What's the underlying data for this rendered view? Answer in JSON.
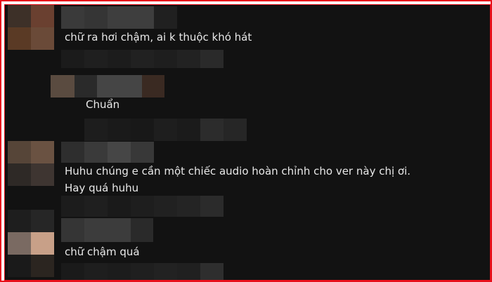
{
  "comments": [
    {
      "text": "chữ ra hơi chậm, ai k thuộc khó hát"
    },
    {
      "text": "Chuẩn"
    },
    {
      "line1": "Huhu chúng e cần một chiếc audio hoàn chỉnh cho ver này chị ơi.",
      "line2": "Hay quá huhu"
    },
    {
      "text": "chữ chậm quá"
    }
  ],
  "colors": {
    "background": "#121212",
    "text": "#e8e8e8",
    "frame_border": "#e8101c"
  }
}
